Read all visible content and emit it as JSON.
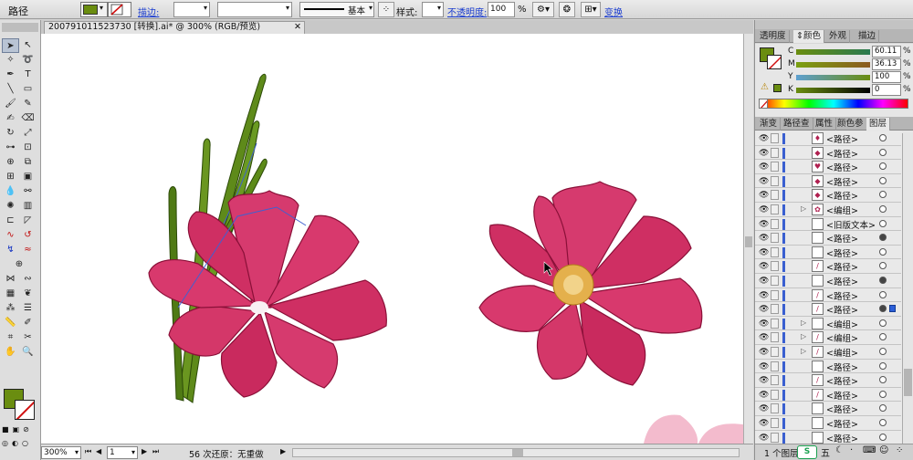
{
  "control_bar": {
    "object_type": "路径",
    "stroke_link": "描边:",
    "line_style_label": "基本",
    "style_label": "样式:",
    "opacity_link": "不透明度:",
    "opacity_value": "100",
    "percent_sign": "%",
    "transform_link": "变换"
  },
  "colors": {
    "fill": "#6a8d10",
    "stroke": "#ffffff",
    "accent": "#3a5fd0"
  },
  "document": {
    "tab_title": "200791011523730 [转换].ai* @ 300% (RGB/预览)",
    "close_glyph": "✕"
  },
  "status_bar": {
    "zoom": "300%",
    "artboard": "1",
    "undo_text": "56 次还原：无重做"
  },
  "panel_tabs_top": [
    "透明度",
    "颜色",
    "外观",
    "描边"
  ],
  "panel_tabs_bottom": [
    "渐变",
    "路径查",
    "属性",
    "颜色参",
    "图层"
  ],
  "color_panel": {
    "c_label": "C",
    "c_value": "60.11",
    "m_label": "M",
    "m_value": "36.13",
    "y_label": "Y",
    "y_value": "100",
    "k_label": "K",
    "k_value": "0",
    "percent": "%"
  },
  "layers": [
    {
      "name": "<路径>",
      "thumb": "♦",
      "target": "empty"
    },
    {
      "name": "<路径>",
      "thumb": "◆",
      "target": "empty"
    },
    {
      "name": "<路径>",
      "thumb": "♥",
      "target": "empty"
    },
    {
      "name": "<路径>",
      "thumb": "◆",
      "target": "empty"
    },
    {
      "name": "<路径>",
      "thumb": "◆",
      "target": "empty"
    },
    {
      "name": "<编组>",
      "thumb": "✿",
      "target": "empty",
      "expand": "▷"
    },
    {
      "name": "<旧版文本>",
      "thumb": "",
      "target": "empty"
    },
    {
      "name": "<路径>",
      "thumb": "",
      "target": "filled"
    },
    {
      "name": "<路径>",
      "thumb": "",
      "target": "empty"
    },
    {
      "name": "<路径>",
      "thumb": "/",
      "target": "empty"
    },
    {
      "name": "<路径>",
      "thumb": "",
      "target": "filled"
    },
    {
      "name": "<路径>",
      "thumb": "/",
      "target": "empty"
    },
    {
      "name": "<路径>",
      "thumb": "/",
      "target": "selected"
    },
    {
      "name": "<编组>",
      "thumb": "",
      "target": "empty",
      "expand": "▷"
    },
    {
      "name": "<编组>",
      "thumb": "/",
      "target": "empty",
      "expand": "▷"
    },
    {
      "name": "<编组>",
      "thumb": "/",
      "target": "empty",
      "expand": "▷"
    },
    {
      "name": "<路径>",
      "thumb": "",
      "target": "empty"
    },
    {
      "name": "<路径>",
      "thumb": "/",
      "target": "empty"
    },
    {
      "name": "<路径>",
      "thumb": "/",
      "target": "empty"
    },
    {
      "name": "<路径>",
      "thumb": "",
      "target": "empty"
    },
    {
      "name": "<路径>",
      "thumb": "",
      "target": "empty"
    },
    {
      "name": "<路径>",
      "thumb": "",
      "target": "empty"
    }
  ],
  "layers_footer": "1 个图层",
  "ime": {
    "label": "五"
  }
}
